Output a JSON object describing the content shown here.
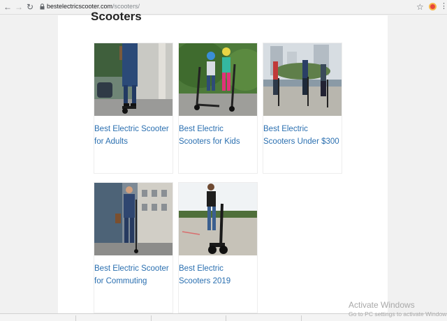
{
  "browser": {
    "url_host": "bestelectricscooter.com",
    "url_path": "/scooters/"
  },
  "page": {
    "title": "Scooters"
  },
  "cards": [
    {
      "title": "Best Electric Scooter for Adults"
    },
    {
      "title": "Best Electric Scooters for Kids"
    },
    {
      "title": "Best Electric Scooters Under $300"
    },
    {
      "title": "Best Electric Scooter for Commuting"
    },
    {
      "title": "Best Electric Scooters 2019"
    }
  ],
  "watermark": {
    "line1": "Activate Windows",
    "line2": "Go to PC settings to activate Windows."
  },
  "colors": {
    "link": "#2a6fb0",
    "page_bg": "#f1f1f1"
  }
}
